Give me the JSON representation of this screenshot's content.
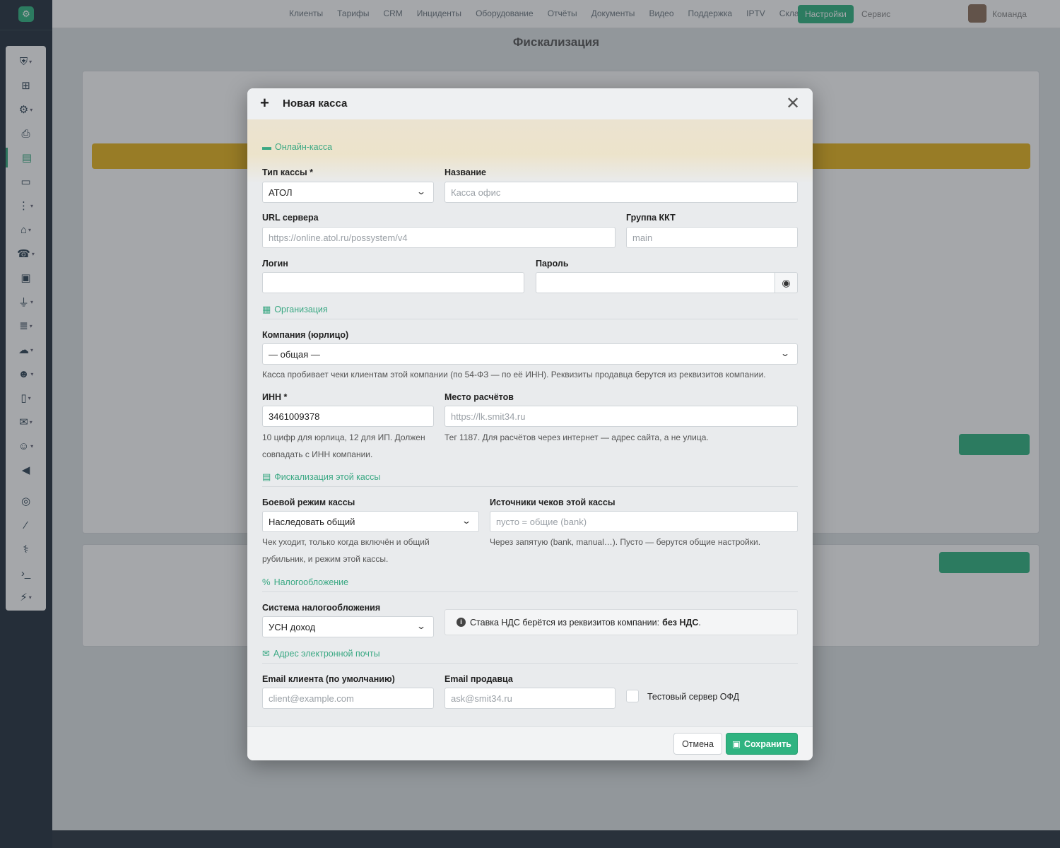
{
  "modal": {
    "title": "Новая касса",
    "sections": {
      "online": "Онлайн-касса",
      "org": "Организация",
      "fiscal": "Фискализация этой кассы",
      "tax": "Налогообложение",
      "email": "Адрес электронной почты"
    },
    "fields": {
      "kassa_type": {
        "label": "Тип кассы *",
        "value": "АТОЛ"
      },
      "name": {
        "label": "Название",
        "placeholder": "Касса офис"
      },
      "url": {
        "label": "URL сервера",
        "placeholder": "https://online.atol.ru/possystem/v4"
      },
      "group": {
        "label": "Группа ККТ",
        "placeholder": "main"
      },
      "login": {
        "label": "Логин",
        "value": ""
      },
      "password": {
        "label": "Пароль",
        "value": ""
      },
      "company": {
        "label": "Компания (юрлицо)",
        "value": "— общая —",
        "help": "Касса пробивает чеки клиентам этой компании (по 54-ФЗ — по её ИНН). Реквизиты продавца берутся из реквизитов компании."
      },
      "inn": {
        "label": "ИНН *",
        "value": "3461009378",
        "help": "10 цифр для юрлица, 12 для ИП. Должен совпадать с ИНН компании."
      },
      "place": {
        "label": "Место расчётов",
        "placeholder": "https://lk.smit34.ru",
        "help": "Тег 1187. Для расчётов через интернет — адрес сайта, а не улица."
      },
      "mode": {
        "label": "Боевой режим кассы",
        "value": "Наследовать общий",
        "help": "Чек уходит, только когда включён и общий рубильник, и режим этой кассы."
      },
      "sources": {
        "label": "Источники чеков этой кассы",
        "placeholder": "пусто = общие (bank)",
        "help": "Через запятую (bank, manual…). Пусто — берутся общие настройки."
      },
      "tax_system": {
        "label": "Система налогообложения",
        "value": "УСН доход"
      },
      "vat_info": {
        "prefix": "Ставка НДС берётся из реквизитов компании:",
        "value": "без НДС",
        "suffix": "."
      },
      "client_email": {
        "label": "Email клиента (по умолчанию)",
        "placeholder": "client@example.com"
      },
      "seller_email": {
        "label": "Email продавца",
        "placeholder": "ask@smit34.ru"
      },
      "test_ofd": {
        "label": "Тестовый сервер ОФД",
        "checked": false
      }
    },
    "buttons": {
      "cancel": "Отмена",
      "save": "Сохранить"
    }
  },
  "background": {
    "page_title": "Фискализация",
    "nav": [
      "Клиенты",
      "Тарифы",
      "CRM",
      "Инциденты",
      "Оборудование",
      "Отчёты",
      "Документы",
      "Видео",
      "Поддержка",
      "IPTV",
      "Склад"
    ],
    "nav_active": "Настройки",
    "nav_after": "Сервис",
    "user": "Команда"
  },
  "colors": {
    "accent": "#2fb380",
    "section": "#3aa883",
    "warning": "#e9b51d"
  }
}
